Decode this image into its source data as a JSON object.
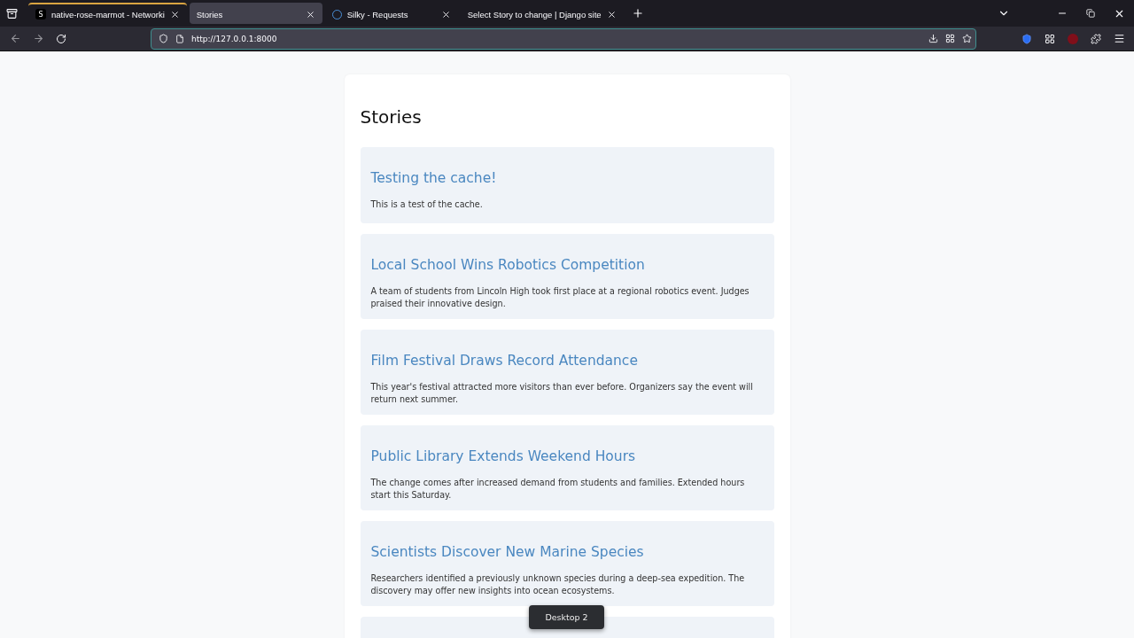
{
  "browser": {
    "tabs": [
      {
        "title": "native-rose-marmot - Networki",
        "selected": false,
        "color": "#d9a441",
        "kind": "lettered",
        "icon_text": "S"
      },
      {
        "title": "Stories",
        "selected": true,
        "kind": "plain"
      },
      {
        "title": "Silky - Requests",
        "selected": false,
        "kind": "loading"
      },
      {
        "title": "Select Story to change | Django site",
        "selected": false,
        "kind": "plain"
      }
    ],
    "url": "http://127.0.0.1:8000"
  },
  "page": {
    "heading": "Stories",
    "stories": [
      {
        "title": "Testing the cache!",
        "summary": "This is a test of the cache."
      },
      {
        "title": "Local School Wins Robotics Competition",
        "summary": "A team of students from Lincoln High took first place at a regional robotics event. Judges praised their innovative design."
      },
      {
        "title": "Film Festival Draws Record Attendance",
        "summary": "This year's festival attracted more visitors than ever before. Organizers say the event will return next summer."
      },
      {
        "title": "Public Library Extends Weekend Hours",
        "summary": "The change comes after increased demand from students and families. Extended hours start this Saturday."
      },
      {
        "title": "Scientists Discover New Marine Species",
        "summary": "Researchers identified a previously unknown species during a deep-sea expedition. The discovery may offer new insights into ocean ecosystems."
      }
    ]
  },
  "overlay": {
    "toast": "Desktop 2"
  }
}
